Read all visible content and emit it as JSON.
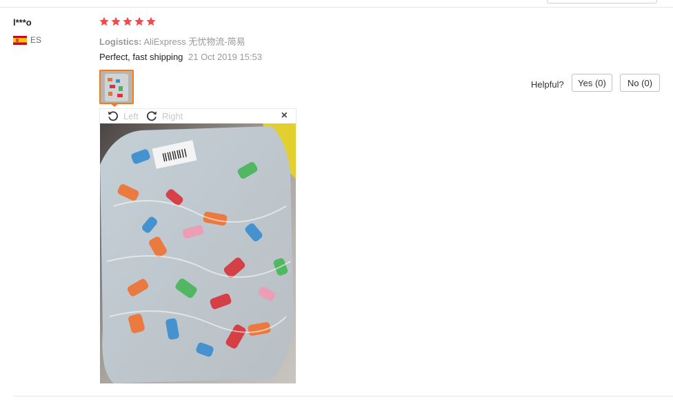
{
  "review": {
    "user": "l***o",
    "country_code": "ES",
    "rating": 5,
    "logistics_label": "Logistics:",
    "logistics_value": "AliExpress 无忧物流-简易",
    "text": "Perfect, fast shipping",
    "date": "21 Oct 2019 15:53"
  },
  "viewer": {
    "rotate_left": "Left",
    "rotate_right": "Right",
    "close": "×"
  },
  "helpful": {
    "label": "Helpful?",
    "yes": "Yes (0)",
    "no": "No (0)"
  },
  "colors": {
    "star": "#f44a4a",
    "thumb_border": "#f07c1b"
  },
  "icons": [
    "flag-es-icon",
    "star-icon",
    "rotate-left-icon",
    "rotate-right-icon",
    "close-icon"
  ]
}
